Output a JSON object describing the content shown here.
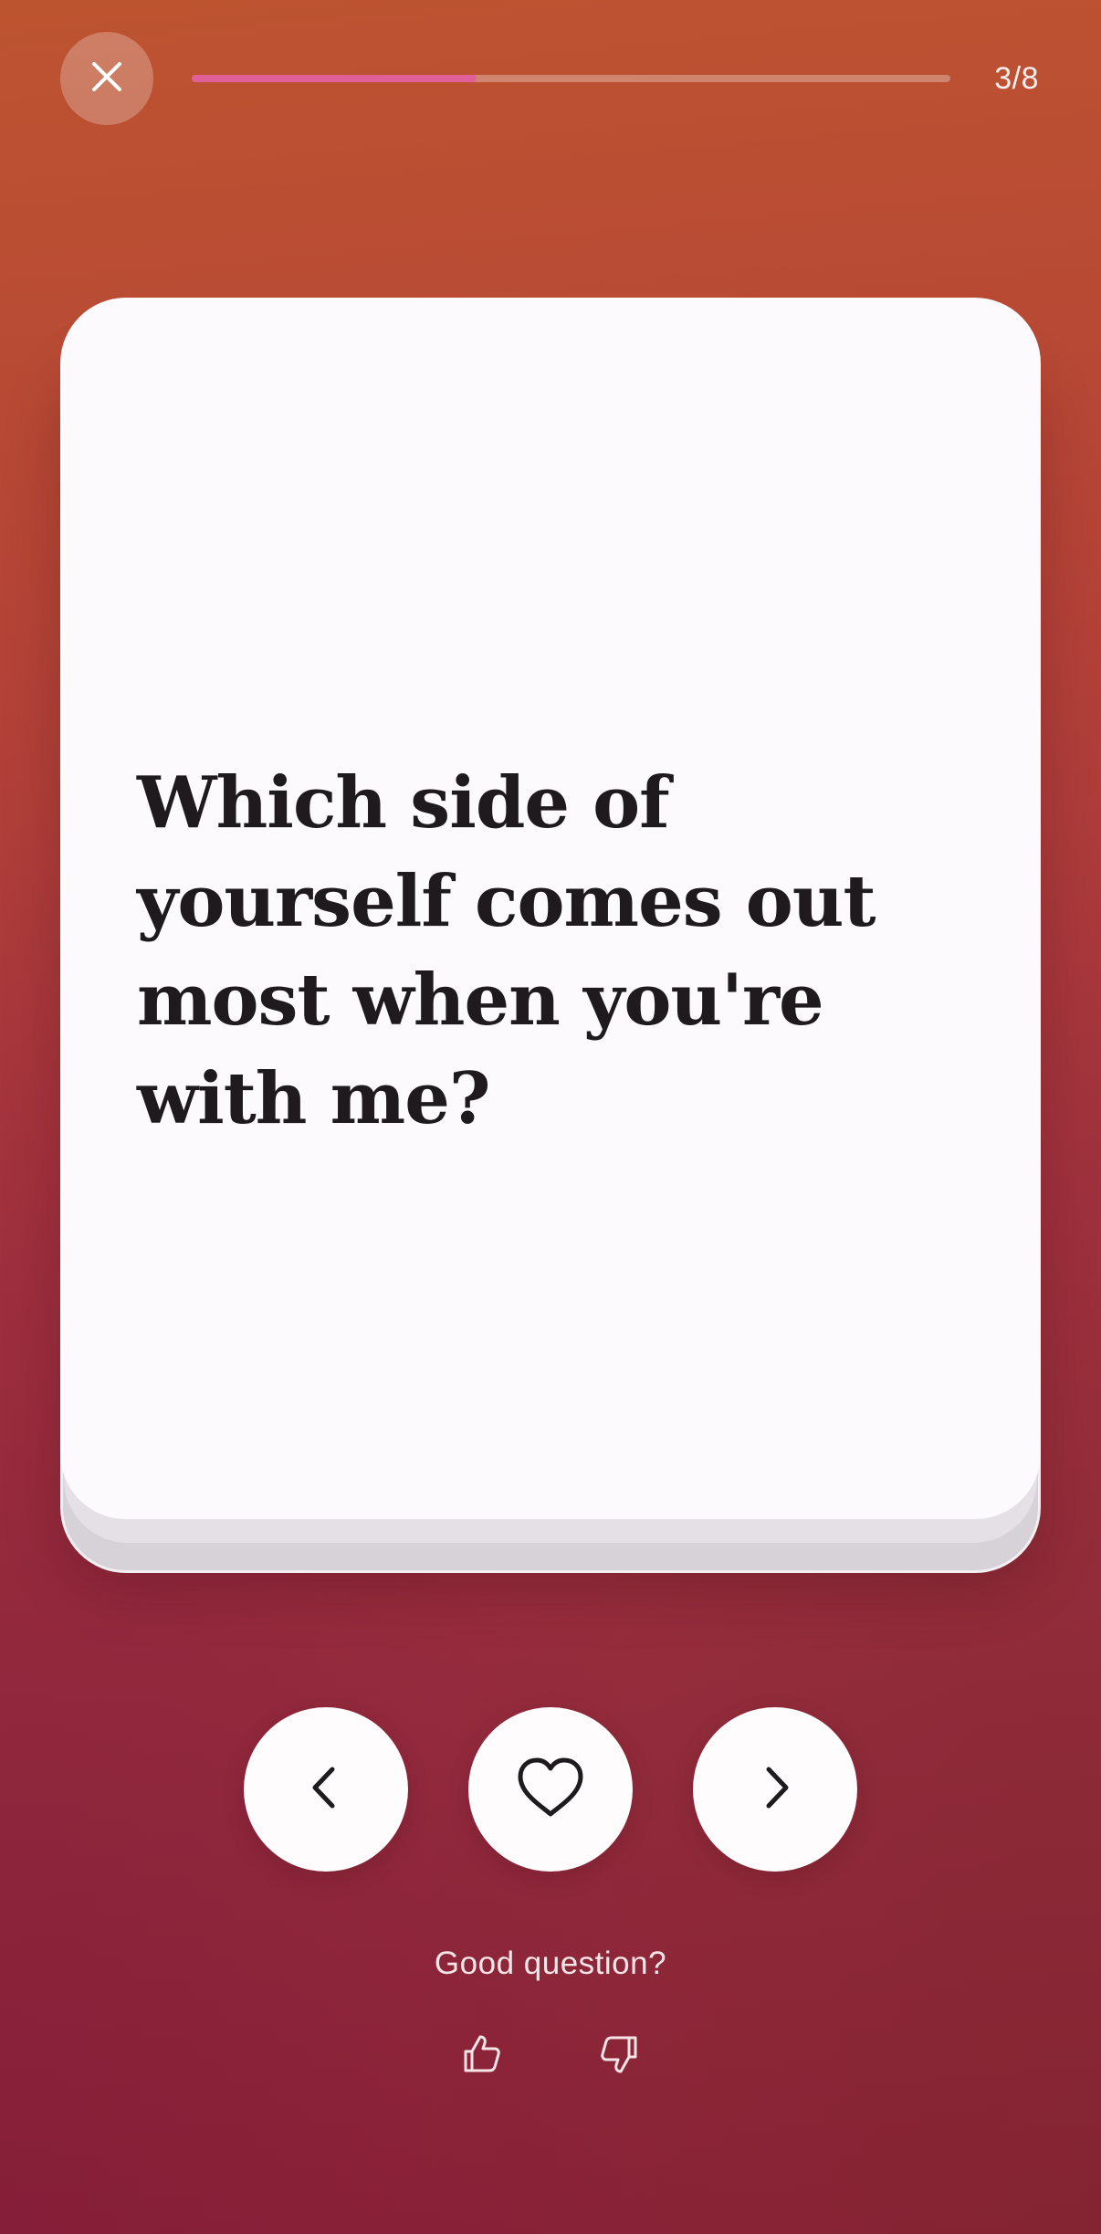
{
  "progress": {
    "current": 3,
    "total": 8,
    "label": "3/8",
    "fill_fraction": 0.375,
    "fill_color": "#e0609a"
  },
  "header": {
    "close_icon": "close-icon"
  },
  "card": {
    "question": "Which side of yourself comes out most when you're with me?"
  },
  "actions": {
    "previous_icon": "chevron-left-icon",
    "like_icon": "heart-icon",
    "next_icon": "chevron-right-icon"
  },
  "feedback": {
    "label": "Good question?",
    "thumbs_up_icon": "thumbs-up-icon",
    "thumbs_down_icon": "thumbs-down-icon"
  },
  "colors": {
    "background_top": "#bd5430",
    "background_bottom": "#8a2137",
    "card": "#fcfafd",
    "text_dark": "#1e1a1d"
  }
}
